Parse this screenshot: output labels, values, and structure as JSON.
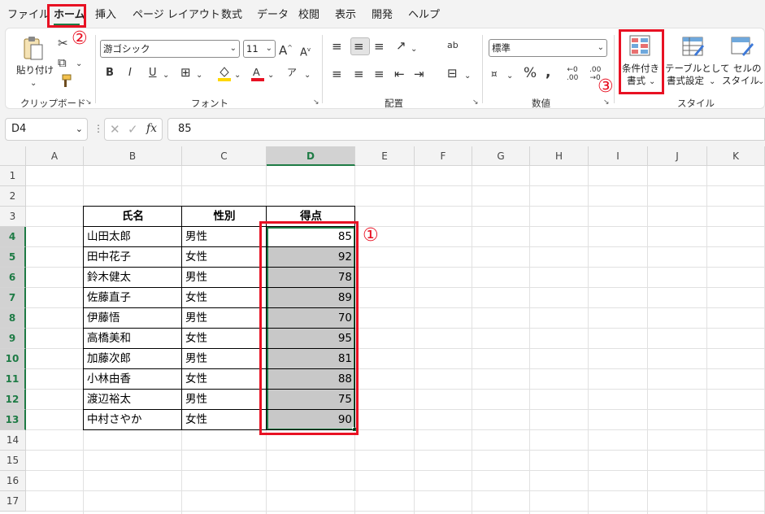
{
  "menu": {
    "items": [
      "ファイル",
      "ホーム",
      "挿入",
      "ページ レイアウト",
      "数式",
      "データ",
      "校閲",
      "表示",
      "開発",
      "ヘルプ"
    ],
    "active_index": 1
  },
  "annotations": {
    "one": "①",
    "two": "②",
    "three": "③",
    "color": "#e81123"
  },
  "ribbon": {
    "clipboard": {
      "paste_label": "貼り付け",
      "group_label": "クリップボード"
    },
    "font": {
      "font_name": "游ゴシック",
      "font_size": "11",
      "group_label": "フォント",
      "font_color": "#e81123",
      "fill_color": "#ffd700"
    },
    "alignment": {
      "group_label": "配置"
    },
    "number": {
      "format": "標準",
      "group_label": "数値"
    },
    "styles": {
      "conditional_line1": "条件付き",
      "conditional_line2": "書式",
      "table_line1": "テーブルとして",
      "table_line2": "書式設定",
      "cell_line1": "セルの",
      "cell_line2": "スタイル",
      "group_label": "スタイル"
    }
  },
  "formula_bar": {
    "name_box": "D4",
    "fx": "fx",
    "value": "85"
  },
  "sheet": {
    "columns": [
      "A",
      "B",
      "C",
      "D",
      "E",
      "F",
      "G",
      "H",
      "I",
      "J",
      "K"
    ],
    "rows": [
      "1",
      "2",
      "3",
      "4",
      "5",
      "6",
      "7",
      "8",
      "9",
      "10",
      "11",
      "12",
      "13",
      "14",
      "15",
      "16",
      "17"
    ],
    "selected_column": "D",
    "table": {
      "headers": [
        "氏名",
        "性別",
        "得点"
      ],
      "rows": [
        {
          "name": "山田太郎",
          "gender": "男性",
          "score": "85"
        },
        {
          "name": "田中花子",
          "gender": "女性",
          "score": "92"
        },
        {
          "name": "鈴木健太",
          "gender": "男性",
          "score": "78"
        },
        {
          "name": "佐藤直子",
          "gender": "女性",
          "score": "89"
        },
        {
          "name": "伊藤悟",
          "gender": "男性",
          "score": "70"
        },
        {
          "name": "高橋美和",
          "gender": "女性",
          "score": "95"
        },
        {
          "name": "加藤次郎",
          "gender": "男性",
          "score": "81"
        },
        {
          "name": "小林由香",
          "gender": "女性",
          "score": "88"
        },
        {
          "name": "渡辺裕太",
          "gender": "男性",
          "score": "75"
        },
        {
          "name": "中村さやか",
          "gender": "女性",
          "score": "90"
        }
      ]
    },
    "selection_color": "#c8c8c8",
    "accent_color": "#1e7b45"
  }
}
